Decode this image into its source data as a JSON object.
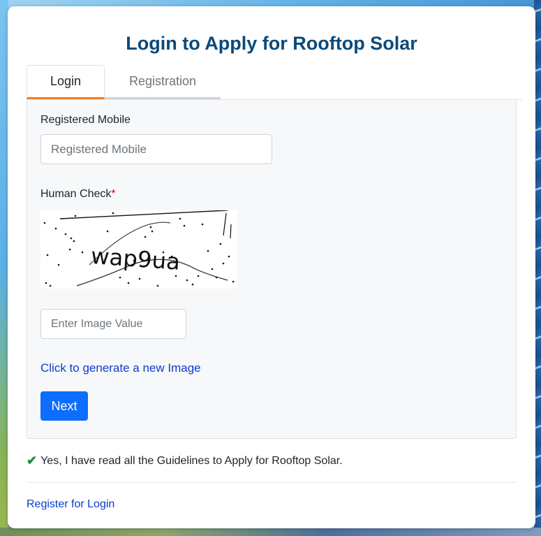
{
  "page": {
    "title": "Login to Apply for Rooftop Solar"
  },
  "tabs": [
    {
      "label": "Login",
      "active": true
    },
    {
      "label": "Registration",
      "active": false
    }
  ],
  "form": {
    "mobile_label": "Registered Mobile",
    "mobile_placeholder": "Registered Mobile",
    "mobile_value": "",
    "human_check_label": "Human Check",
    "required_mark": "*",
    "captcha_text": "wap9ua",
    "captcha_input_placeholder": "Enter Image Value",
    "captcha_input_value": "",
    "new_image_link": "Click to generate a new Image",
    "next_button": "Next"
  },
  "guidelines": {
    "text": "Yes, I have read all the Guidelines to Apply for Rooftop Solar."
  },
  "footer": {
    "register_link": "Register for Login"
  },
  "colors": {
    "title": "#0b4a7a",
    "active_tab_accent": "#f47c20",
    "primary_button": "#0d6efd",
    "link": "#0a3ccf",
    "check": "#1e8e3e",
    "required": "#d00000"
  },
  "icons": {
    "check": "check-icon"
  }
}
